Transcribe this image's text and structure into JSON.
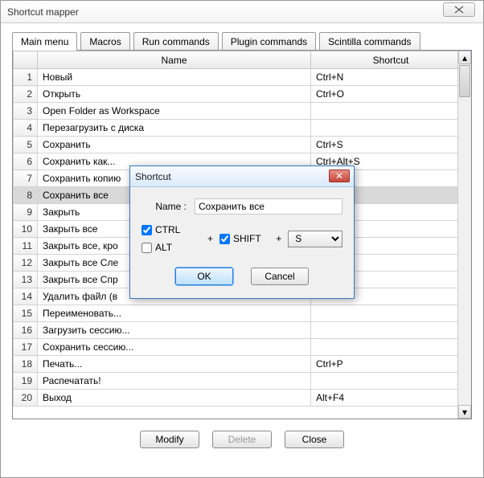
{
  "window": {
    "title": "Shortcut mapper"
  },
  "tabs": [
    {
      "label": "Main menu",
      "active": true
    },
    {
      "label": "Macros",
      "active": false
    },
    {
      "label": "Run commands",
      "active": false
    },
    {
      "label": "Plugin commands",
      "active": false
    },
    {
      "label": "Scintilla commands",
      "active": false
    }
  ],
  "columns": {
    "rowhdr": "",
    "name": "Name",
    "shortcut": "Shortcut"
  },
  "rows": [
    {
      "n": "1",
      "name": "Новый",
      "shortcut": "Ctrl+N"
    },
    {
      "n": "2",
      "name": "Открыть",
      "shortcut": "Ctrl+O"
    },
    {
      "n": "3",
      "name": "Open Folder as Workspace",
      "shortcut": ""
    },
    {
      "n": "4",
      "name": "Перезагрузить с диска",
      "shortcut": ""
    },
    {
      "n": "5",
      "name": "Сохранить",
      "shortcut": "Ctrl+S"
    },
    {
      "n": "6",
      "name": "Сохранить как...",
      "shortcut": "Ctrl+Alt+S"
    },
    {
      "n": "7",
      "name": "Сохранить копию",
      "shortcut": ""
    },
    {
      "n": "8",
      "name": "Сохранить все",
      "shortcut": "ft+S"
    },
    {
      "n": "9",
      "name": "Закрыть",
      "shortcut": ""
    },
    {
      "n": "10",
      "name": "Закрыть все",
      "shortcut": ""
    },
    {
      "n": "11",
      "name": "Закрыть все, кро",
      "shortcut": ""
    },
    {
      "n": "12",
      "name": "Закрыть все Сле",
      "shortcut": ""
    },
    {
      "n": "13",
      "name": "Закрыть все Спр",
      "shortcut": ""
    },
    {
      "n": "14",
      "name": "Удалить файл (в",
      "shortcut": ""
    },
    {
      "n": "15",
      "name": "Переименовать...",
      "shortcut": ""
    },
    {
      "n": "16",
      "name": "Загрузить сессию...",
      "shortcut": ""
    },
    {
      "n": "17",
      "name": "Сохранить сессию...",
      "shortcut": ""
    },
    {
      "n": "18",
      "name": "Печать...",
      "shortcut": "Ctrl+P"
    },
    {
      "n": "19",
      "name": "Распечатать!",
      "shortcut": ""
    },
    {
      "n": "20",
      "name": "Выход",
      "shortcut": "Alt+F4"
    }
  ],
  "selected_row": 8,
  "footer": {
    "modify": "Modify",
    "delete": "Delete",
    "close": "Close"
  },
  "dialog": {
    "title": "Shortcut",
    "name_label": "Name :",
    "name_value": "Сохранить все",
    "ctrl_label": "CTRL",
    "ctrl_checked": true,
    "alt_label": "ALT",
    "alt_checked": false,
    "shift_label": "SHIFT",
    "shift_checked": true,
    "plus": "+",
    "key": "S",
    "ok": "OK",
    "cancel": "Cancel",
    "close_x": "✕"
  }
}
